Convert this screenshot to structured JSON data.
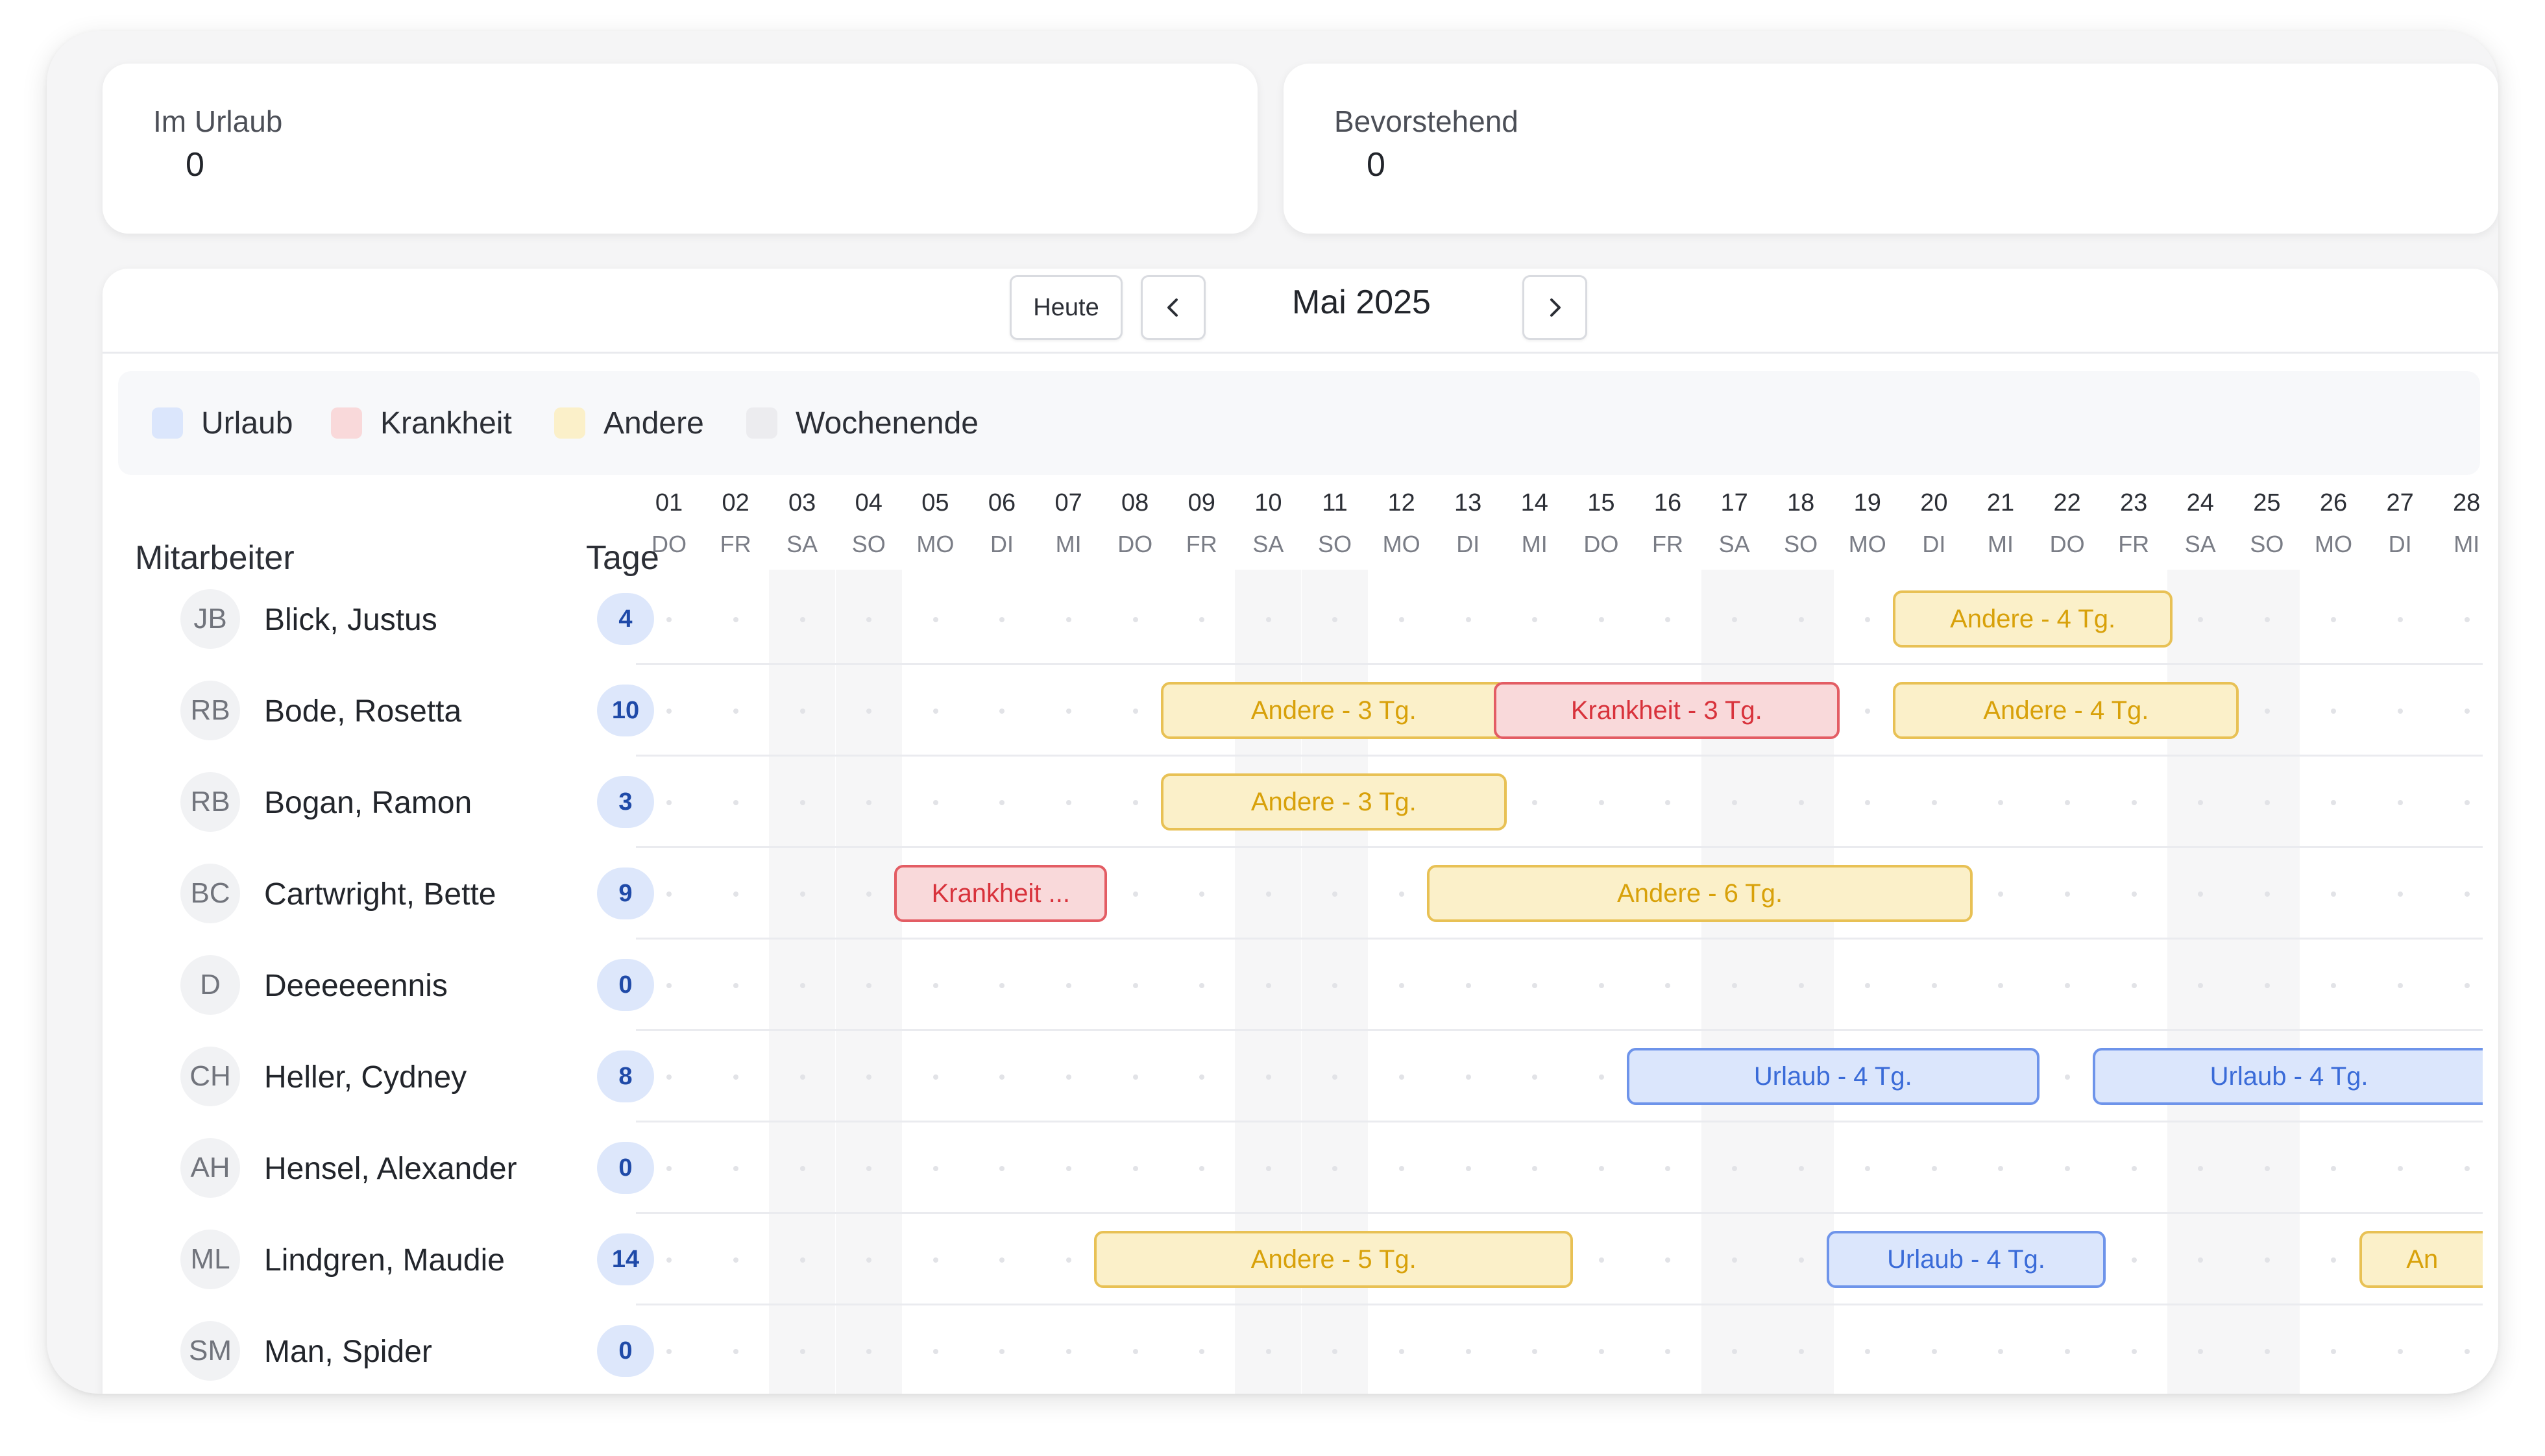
{
  "stats": [
    {
      "label": "Im Urlaub",
      "value": "0"
    },
    {
      "label": "Bevorstehend",
      "value": "0"
    }
  ],
  "toolbar": {
    "today_label": "Heute",
    "month": "Mai 2025"
  },
  "legend": [
    {
      "label": "Urlaub",
      "color": "#dbe6fc"
    },
    {
      "label": "Krankheit",
      "color": "#f9d9da"
    },
    {
      "label": "Andere",
      "color": "#fbf0c9"
    },
    {
      "label": "Wochenende",
      "color": "#ececef"
    }
  ],
  "columns": {
    "employee": "Mitarbeiter",
    "days": "Tage"
  },
  "days": [
    {
      "num": "01",
      "wd": "DO"
    },
    {
      "num": "02",
      "wd": "FR"
    },
    {
      "num": "03",
      "wd": "SA"
    },
    {
      "num": "04",
      "wd": "SO"
    },
    {
      "num": "05",
      "wd": "MO"
    },
    {
      "num": "06",
      "wd": "DI"
    },
    {
      "num": "07",
      "wd": "MI"
    },
    {
      "num": "08",
      "wd": "DO"
    },
    {
      "num": "09",
      "wd": "FR"
    },
    {
      "num": "10",
      "wd": "SA"
    },
    {
      "num": "11",
      "wd": "SO"
    },
    {
      "num": "12",
      "wd": "MO"
    },
    {
      "num": "13",
      "wd": "DI"
    },
    {
      "num": "14",
      "wd": "MI"
    },
    {
      "num": "15",
      "wd": "DO"
    },
    {
      "num": "16",
      "wd": "FR"
    },
    {
      "num": "17",
      "wd": "SA"
    },
    {
      "num": "18",
      "wd": "SO"
    },
    {
      "num": "19",
      "wd": "MO"
    },
    {
      "num": "20",
      "wd": "DI"
    },
    {
      "num": "21",
      "wd": "MI"
    },
    {
      "num": "22",
      "wd": "DO"
    },
    {
      "num": "23",
      "wd": "FR"
    },
    {
      "num": "24",
      "wd": "SA"
    },
    {
      "num": "25",
      "wd": "SO"
    },
    {
      "num": "26",
      "wd": "MO"
    },
    {
      "num": "27",
      "wd": "DI"
    },
    {
      "num": "28",
      "wd": "MI"
    }
  ],
  "employees": [
    {
      "initials": "JB",
      "name": "Blick, Justus",
      "days": "4",
      "absences": [
        {
          "type": "Andere",
          "label": "Andere - 4 Tg.",
          "start": 20,
          "end": 23
        }
      ]
    },
    {
      "initials": "RB",
      "name": "Bode, Rosetta",
      "days": "10",
      "absences": [
        {
          "type": "Andere",
          "label": "Andere - 3 Tg.",
          "start": 9,
          "end": 13
        },
        {
          "type": "Krankheit",
          "label": "Krankheit - 3 Tg.",
          "start": 14,
          "end": 18
        },
        {
          "type": "Andere",
          "label": "Andere - 4 Tg.",
          "start": 20,
          "end": 24
        }
      ]
    },
    {
      "initials": "RB",
      "name": "Bogan, Ramon",
      "days": "3",
      "absences": [
        {
          "type": "Andere",
          "label": "Andere - 3 Tg.",
          "start": 9,
          "end": 13
        }
      ]
    },
    {
      "initials": "BC",
      "name": "Cartwright, Bette",
      "days": "9",
      "absences": [
        {
          "type": "Krankheit",
          "label": "Krankheit ...",
          "start": 5,
          "end": 7
        },
        {
          "type": "Andere",
          "label": "Andere - 6 Tg.",
          "start": 13,
          "end": 20
        }
      ]
    },
    {
      "initials": "D",
      "name": "Deeeeeennis",
      "days": "0",
      "absences": []
    },
    {
      "initials": "CH",
      "name": "Heller, Cydney",
      "days": "8",
      "absences": [
        {
          "type": "Urlaub",
          "label": "Urlaub - 4 Tg.",
          "start": 16,
          "end": 21
        },
        {
          "type": "Urlaub",
          "label": "Urlaub - 4 Tg.",
          "start": 23,
          "end": 28
        }
      ]
    },
    {
      "initials": "AH",
      "name": "Hensel, Alexander",
      "days": "0",
      "absences": []
    },
    {
      "initials": "ML",
      "name": "Lindgren, Maudie",
      "days": "14",
      "absences": [
        {
          "type": "Andere",
          "label": "Andere - 5 Tg.",
          "start": 8,
          "end": 14
        },
        {
          "type": "Urlaub",
          "label": "Urlaub - 4 Tg.",
          "start": 19,
          "end": 22
        },
        {
          "type": "Andere",
          "label": "An",
          "start": 27,
          "end": 28
        }
      ]
    },
    {
      "initials": "SM",
      "name": "Man, Spider",
      "days": "0",
      "absences": []
    }
  ]
}
